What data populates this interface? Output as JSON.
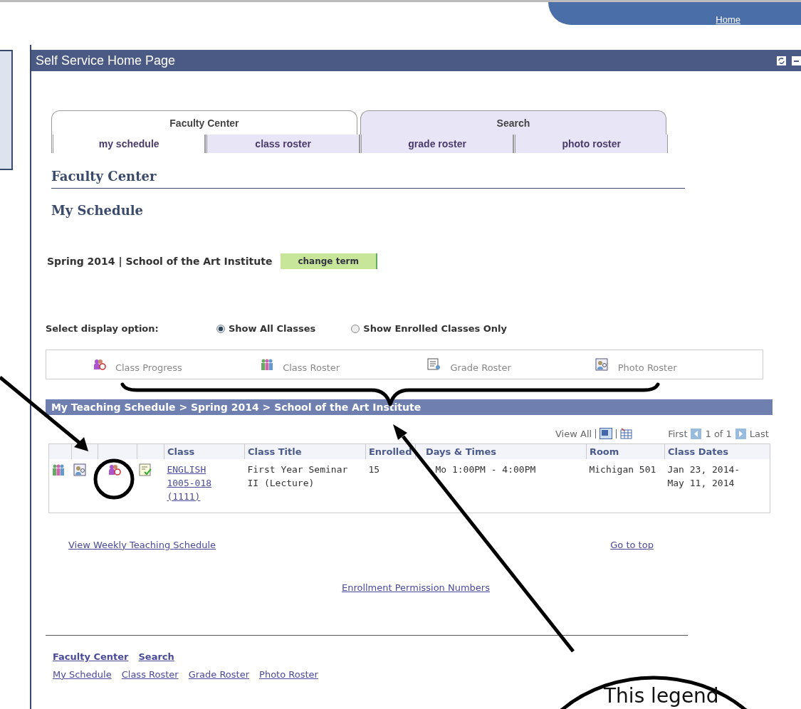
{
  "top_bar": {
    "home_link": "Home"
  },
  "portlet": {
    "title": "Self Service Home Page"
  },
  "tabs": [
    {
      "label": "Faculty Center",
      "selected": true
    },
    {
      "label": "Search",
      "selected": false
    }
  ],
  "subtabs": [
    {
      "label": "my schedule",
      "selected": true
    },
    {
      "label": "class roster",
      "selected": false
    },
    {
      "label": "grade roster",
      "selected": false
    },
    {
      "label": "photo roster",
      "selected": false
    }
  ],
  "section_title": "Faculty Center",
  "page_title": "My Schedule",
  "term": {
    "label": "Spring 2014 | School of the Art Institute",
    "button": "change term"
  },
  "display_option": {
    "label": "Select display option:",
    "options": [
      {
        "label": "Show All Classes",
        "selected": true
      },
      {
        "label": "Show Enrolled Classes Only",
        "selected": false
      }
    ]
  },
  "legend": [
    {
      "kind": "progress",
      "label": "Class Progress"
    },
    {
      "kind": "roster",
      "label": "Class Roster"
    },
    {
      "kind": "grade",
      "label": "Grade Roster"
    },
    {
      "kind": "photo",
      "label": "Photo Roster"
    }
  ],
  "schedule": {
    "title": "My Teaching Schedule > Spring 2014 > School of the Art Institute",
    "view_all": "View All",
    "first": "First",
    "page": "1 of 1",
    "last": "Last",
    "columns": [
      "Class",
      "Class Title",
      "Enrolled",
      "Days & Times",
      "Room",
      "Class Dates"
    ],
    "rows": [
      {
        "class": "ENGLISH 1005-018 (1111)",
        "title": "First Year Seminar II (Lecture)",
        "enrolled": "15",
        "days_times": "Mo 1:00PM - 4:00PM",
        "room": "Michigan 501",
        "dates": "Jan 23, 2014- May 11, 2014"
      }
    ]
  },
  "links": {
    "weekly": "View Weekly Teaching Schedule",
    "top": "Go to top",
    "permission": "Enrollment Permission Numbers"
  },
  "footer": {
    "primary": [
      "Faculty Center",
      "Search"
    ],
    "secondary": [
      "My Schedule",
      "Class Roster",
      "Grade Roster",
      "Photo Roster"
    ]
  },
  "annotation": {
    "callout": "This legend"
  }
}
